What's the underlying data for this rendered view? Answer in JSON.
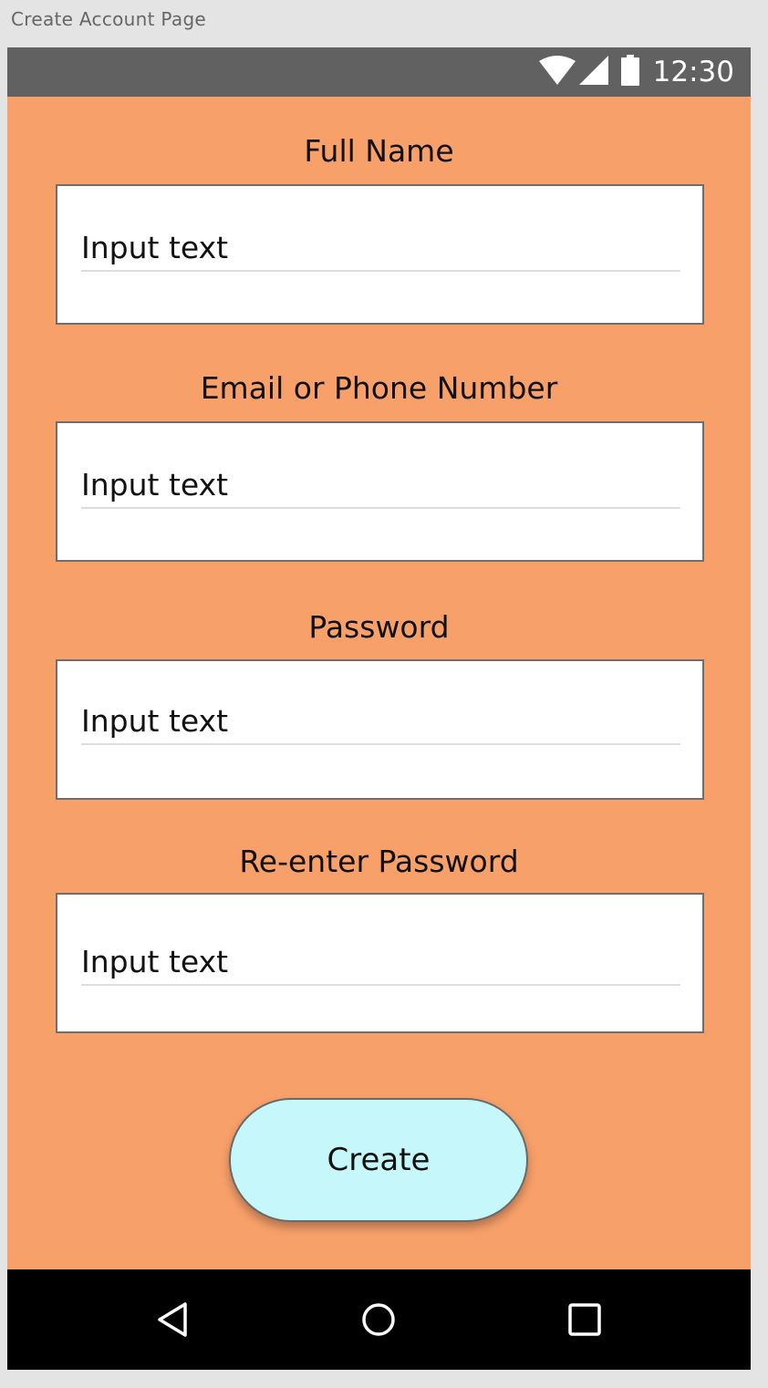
{
  "window": {
    "title": "Create Account Page"
  },
  "status_bar": {
    "time": "12:30",
    "icons": [
      "wifi-icon",
      "signal-icon",
      "battery-icon"
    ]
  },
  "form": {
    "fields": [
      {
        "label": "Full Name",
        "placeholder": "Input text",
        "value": ""
      },
      {
        "label": "Email or Phone Number",
        "placeholder": "Input text",
        "value": ""
      },
      {
        "label": "Password",
        "placeholder": "Input text",
        "value": ""
      },
      {
        "label": "Re-enter Password",
        "placeholder": "Input text",
        "value": ""
      }
    ],
    "submit_label": "Create"
  },
  "nav_bar": {
    "buttons": [
      "back-icon",
      "home-icon",
      "recents-icon"
    ]
  },
  "colors": {
    "background": "#f8a06a",
    "status_bar": "#616161",
    "button": "#c6f8fb",
    "nav_bar": "#000000",
    "frame": "#e4e4e4"
  }
}
